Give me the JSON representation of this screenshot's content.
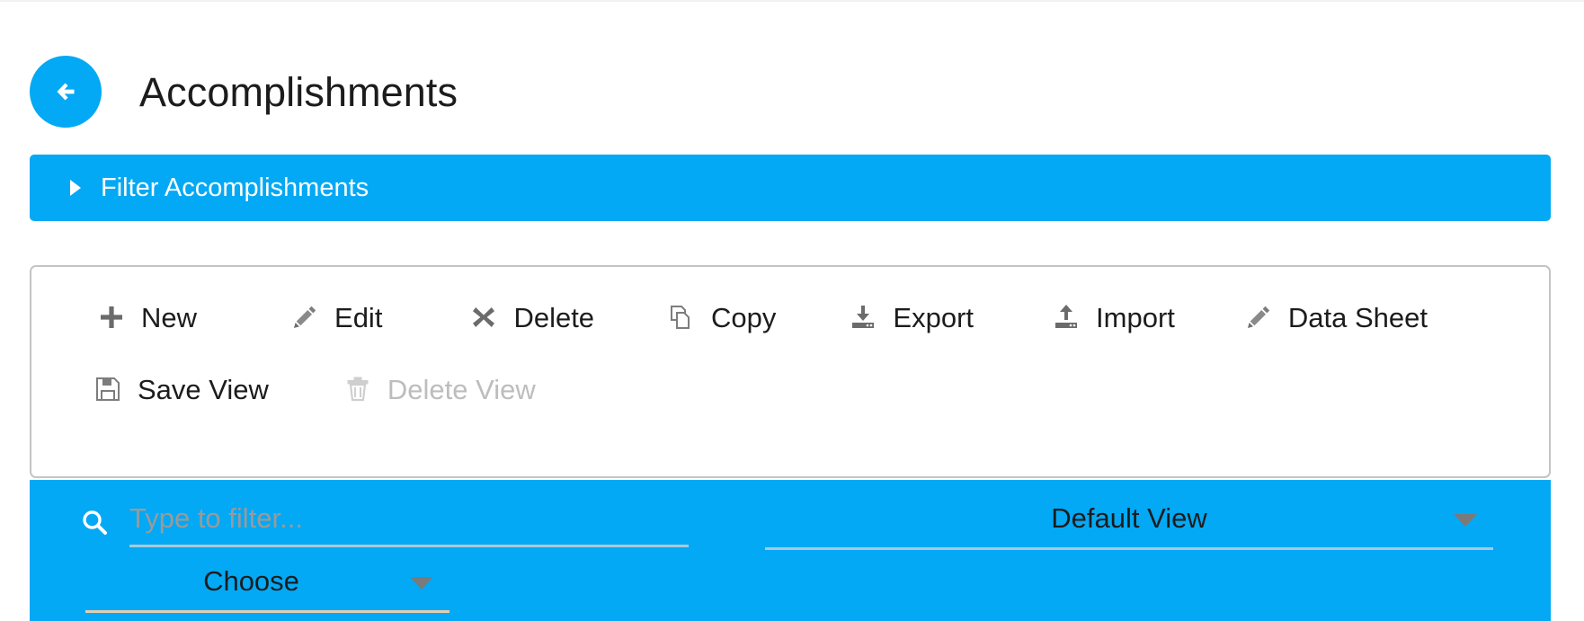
{
  "header": {
    "back_icon": "arrow-left-icon",
    "title": "Accomplishments",
    "accent_color": "#03a9f4"
  },
  "filter": {
    "label": "Filter Accomplishments",
    "caret_icon": "triangle-right-icon",
    "expanded": false,
    "background_color": "#03a9f4"
  },
  "toolbar": {
    "row1": [
      {
        "label": "New",
        "icon": "plus-icon",
        "enabled": true
      },
      {
        "label": "Edit",
        "icon": "pencil-icon",
        "enabled": true
      },
      {
        "label": "Delete",
        "icon": "close-x-icon",
        "enabled": true
      },
      {
        "label": "Copy",
        "icon": "copy-icon",
        "enabled": true
      },
      {
        "label": "Export",
        "icon": "download-icon",
        "enabled": true
      },
      {
        "label": "Import",
        "icon": "upload-icon",
        "enabled": true
      },
      {
        "label": "Data Sheet",
        "icon": "pencil-icon",
        "enabled": true
      }
    ],
    "row2": [
      {
        "label": "Save View",
        "icon": "floppy-disk-icon",
        "enabled": true
      },
      {
        "label": "Delete View",
        "icon": "trash-icon",
        "enabled": false
      }
    ]
  },
  "search_bar": {
    "background_color": "#03a9f4",
    "search_icon": "search-icon",
    "search_value": "",
    "search_placeholder": "Type to filter...",
    "view_select": {
      "selected": "Default View",
      "caret_icon": "chevron-down-icon"
    },
    "choose_select": {
      "selected": "Choose",
      "caret_icon": "chevron-down-icon"
    }
  }
}
